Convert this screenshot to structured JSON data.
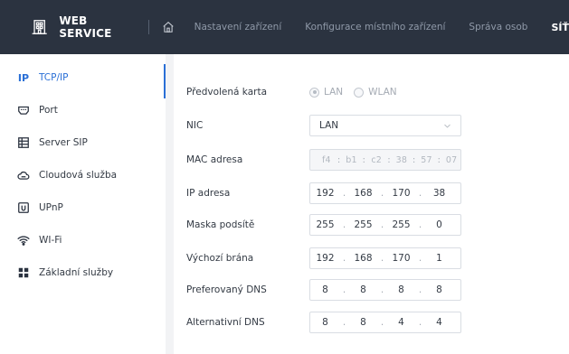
{
  "header": {
    "brand": "WEB SERVICE",
    "nav": [
      "Nastavení zařízení",
      "Konfigurace místního zařízení",
      "Správa osob"
    ],
    "active_nav": "SÍŤ"
  },
  "sidebar": {
    "items": [
      {
        "label": "TCP/IP",
        "icon": "ip-icon",
        "active": true
      },
      {
        "label": "Port",
        "icon": "port-icon"
      },
      {
        "label": "Server SIP",
        "icon": "server-sip-icon"
      },
      {
        "label": "Cloudová služba",
        "icon": "cloud-icon"
      },
      {
        "label": "UPnP",
        "icon": "upnp-icon"
      },
      {
        "label": "WI-Fi",
        "icon": "wifi-icon"
      },
      {
        "label": "Základní služby",
        "icon": "basic-services-icon"
      }
    ]
  },
  "form": {
    "default_card": {
      "label": "Předvolená karta",
      "options": [
        "LAN",
        "WLAN"
      ],
      "selected": "LAN"
    },
    "nic": {
      "label": "NIC",
      "value": "LAN"
    },
    "mac": {
      "label": "MAC adresa",
      "octets": [
        "f4",
        "b1",
        "c2",
        "38",
        "57",
        "07"
      ]
    },
    "ip": {
      "label": "IP adresa",
      "octets": [
        "192",
        "168",
        "170",
        "38"
      ]
    },
    "mask": {
      "label": "Maska podsítě",
      "octets": [
        "255",
        "255",
        "255",
        "0"
      ]
    },
    "gateway": {
      "label": "Výchozí brána",
      "octets": [
        "192",
        "168",
        "170",
        "1"
      ]
    },
    "dns1": {
      "label": "Preferovaný DNS",
      "octets": [
        "8",
        "8",
        "8",
        "8"
      ]
    },
    "dns2": {
      "label": "Alternativní DNS",
      "octets": [
        "8",
        "8",
        "4",
        "4"
      ]
    }
  },
  "colors": {
    "topbar": "#2b3340",
    "accent": "#2a6fd6"
  }
}
